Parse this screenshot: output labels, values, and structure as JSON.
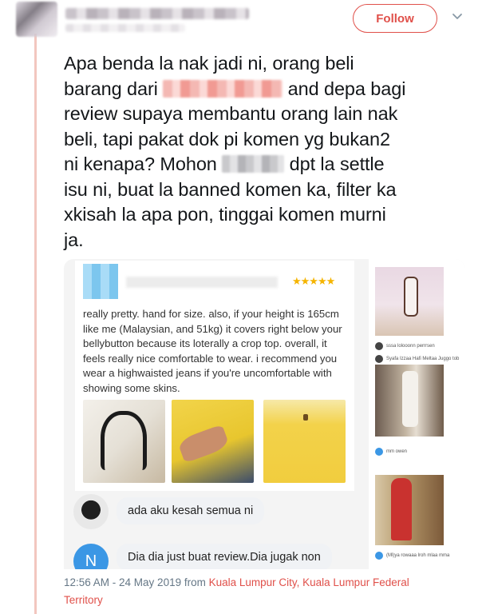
{
  "header": {
    "follow_label": "Follow"
  },
  "tweet": {
    "line1": "Apa benda la nak jadi ni, orang beli",
    "line2a": "barang dari ",
    "line2b": " and depa bagi",
    "line3": "review supaya membantu orang lain nak",
    "line4": "beli, tapi pakat dok pi komen yg bukan2",
    "line5a": "ni kenapa? Mohon ",
    "line5b": " dpt la settle",
    "line6": "isu ni, buat la banned komen ka, filter ka",
    "line7": "xkisah la apa pon, tinggai komen murni",
    "line8": "ja."
  },
  "review": {
    "stars": "★★★★★",
    "body": "really pretty. hand for size. also, if your height is 165cm like me (Malaysian, and 51kg) it covers right below your bellybutton because its loterally a crop top. overall, it feels really nice comfortable to wear. i recommend you wear a highwaisted jeans if you're uncomfortable with showing some skins."
  },
  "comments": [
    {
      "avatar": "",
      "text": "ada aku kesah semua ni"
    },
    {
      "avatar": "N",
      "text": "Dia dia just buat review.Dia jugak non"
    }
  ],
  "side_rows": [
    {
      "text": "sssa lolooonn perrrsen"
    },
    {
      "text": "Syafa Izzaa Hafi Meltaa Juggo tob"
    },
    {
      "text": "mm owen"
    },
    {
      "text": "(Ml)ya rowaaa lroh mlaa mma"
    }
  ],
  "footer": {
    "time": "12:56 AM - 24 May 2019 from ",
    "location_line1": "Kuala Lumpur City, Kuala Lumpur Federal",
    "location_line2": "Territory"
  },
  "colors": {
    "accent": "#e0504a",
    "text": "#14171a",
    "muted": "#657786",
    "stars": "#f5b400"
  }
}
